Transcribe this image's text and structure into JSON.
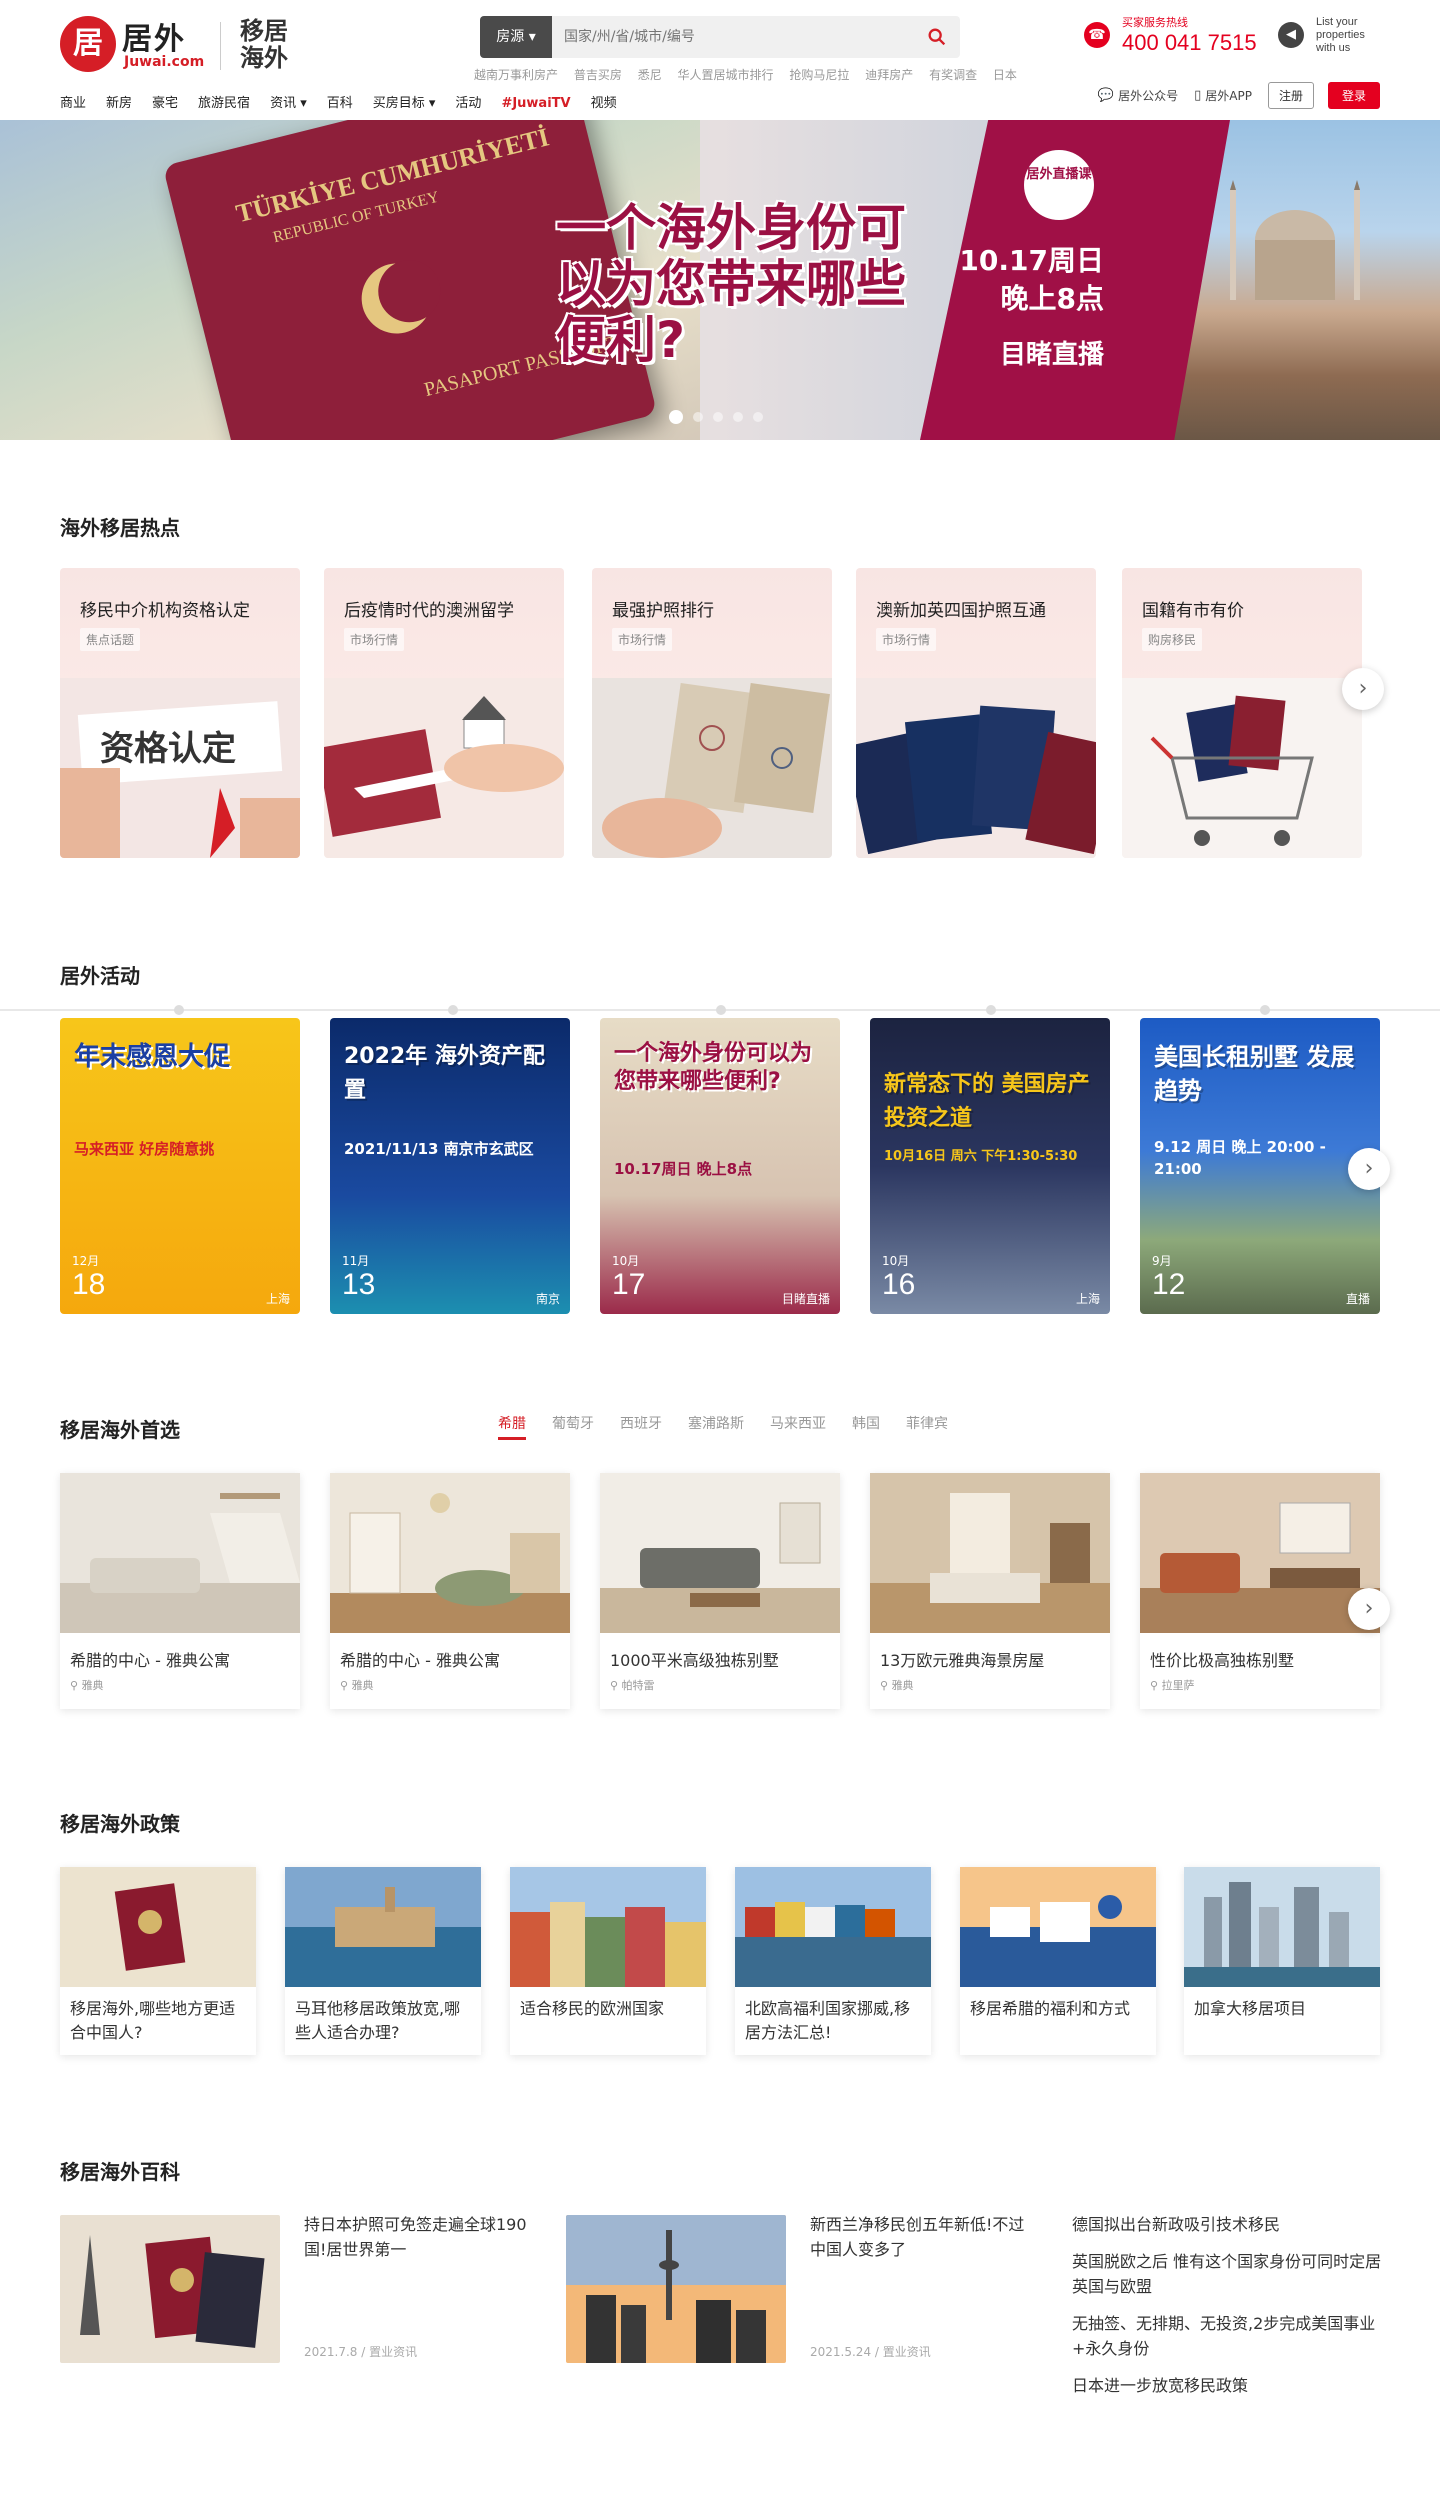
{
  "header": {
    "logo_cn": "居外",
    "logo_en": "Juwai.com",
    "logo_mark": "居",
    "slogan": "移居海外",
    "search_type": "房源 ▾",
    "search_placeholder": "国家/州/省/城市/编号",
    "hotwords": [
      "越南万事利房产",
      "普吉买房",
      "悉尼",
      "华人置居城市排行",
      "抢购马尼拉",
      "迪拜房产",
      "有奖调查",
      "日本"
    ],
    "hotline_label": "买家服务热线",
    "hotline_number": "400 041 7515",
    "list_properties": "List your properties with us",
    "nav": [
      "商业",
      "新房",
      "豪宅",
      "旅游民宿",
      "资讯 ▾",
      "百科",
      "买房目标 ▾",
      "活动",
      "#JuwaiTV",
      "视频"
    ],
    "wechat": "居外公众号",
    "app": "居外APP",
    "register": "注册",
    "login": "登录"
  },
  "banner": {
    "passport_title": "TÜRKİYE CUMHURİYETİ",
    "passport_sub": "REPUBLIC OF TURKEY",
    "passport_word": "PASAPORT PASSPORT",
    "headline": "一个海外身份可以为您带来哪些便利?",
    "badge": "居外直播课",
    "date": "10.17周日 晚上8点",
    "live": "目睹直播",
    "slide_count": 5,
    "active_slide": 1
  },
  "hot": {
    "title": "海外移居热点",
    "cards": [
      {
        "title": "移民中介机构资格认定",
        "tag": "焦点话题",
        "image_text": "资格认定"
      },
      {
        "title": "后疫情时代的澳洲留学",
        "tag": "市场行情"
      },
      {
        "title": "最强护照排行",
        "tag": "市场行情"
      },
      {
        "title": "澳新加英四国护照互通",
        "tag": "市场行情"
      },
      {
        "title": "国籍有市有价",
        "tag": "购房移民"
      }
    ]
  },
  "activities": {
    "title": "居外活动",
    "cards": [
      {
        "title": "年末感恩大促",
        "sub": "马来西亚 好房随意挑",
        "month": "12月",
        "day": "18",
        "city": "上海"
      },
      {
        "title": "2022年 海外资产配置",
        "sub": "2021/11/13 南京市玄武区",
        "month": "11月",
        "day": "13",
        "city": "南京"
      },
      {
        "title": "一个海外身份可以为您带来哪些便利?",
        "sub": "10.17周日 晚上8点",
        "month": "10月",
        "day": "17",
        "city": "目睹直播"
      },
      {
        "title": "新常态下的 美国房产投资之道",
        "sub": "10月16日 周六 下午1:30-5:30",
        "month": "10月",
        "day": "16",
        "city": "上海"
      },
      {
        "title": "美国长租别墅 发展趋势",
        "sub": "9.12 周日 晚上 20:00 - 21:00",
        "month": "9月",
        "day": "12",
        "city": "直播"
      }
    ]
  },
  "picks": {
    "title": "移居海外首选",
    "tabs": [
      "希腊",
      "葡萄牙",
      "西班牙",
      "塞浦路斯",
      "马来西亚",
      "韩国",
      "菲律宾"
    ],
    "cards": [
      {
        "title": "希腊的中心 - 雅典公寓",
        "loc": "雅典"
      },
      {
        "title": "希腊的中心 - 雅典公寓",
        "loc": "雅典"
      },
      {
        "title": "1000平米高级独栋别墅",
        "loc": "帕特雷"
      },
      {
        "title": "13万欧元雅典海景房屋",
        "loc": "雅典"
      },
      {
        "title": "性价比极高独栋别墅",
        "loc": "拉里萨"
      }
    ]
  },
  "policy": {
    "title": "移居海外政策",
    "cards": [
      {
        "title": "移居海外,哪些地方更适合中国人?"
      },
      {
        "title": "马耳他移居政策放宽,哪些人适合办理?"
      },
      {
        "title": "适合移民的欧洲国家"
      },
      {
        "title": "北欧高福利国家挪威,移居方法汇总!"
      },
      {
        "title": "移居希腊的福利和方式"
      },
      {
        "title": "加拿大移居项目"
      }
    ]
  },
  "wiki": {
    "title": "移居海外百科",
    "articles": [
      {
        "title": "持日本护照可免签走遍全球190国!居世界第一",
        "date": "2021.7.8 / 置业资讯"
      },
      {
        "title": "新西兰净移民创五年新低!不过中国人变多了",
        "date": "2021.5.24 / 置业资讯"
      }
    ],
    "list": [
      "德国拟出台新政吸引技术移民",
      "英国脱欧之后 惟有这个国家身份可同时定居英国与欧盟",
      "无抽签、无排期、无投资,2步完成美国事业+永久身份",
      "日本进一步放宽移民政策"
    ]
  }
}
